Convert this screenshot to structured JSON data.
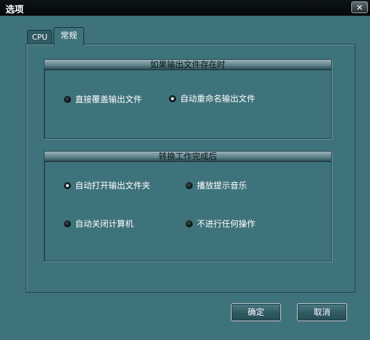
{
  "window": {
    "title": "选项",
    "close_glyph": "✕"
  },
  "tabs": [
    {
      "label": "CPU",
      "active": false
    },
    {
      "label": "常规",
      "active": true
    }
  ],
  "groups": {
    "output_exists": {
      "header": "如果输出文件存在时",
      "options": [
        {
          "label": "直接覆盖输出文件",
          "checked": false
        },
        {
          "label": "自动重命名输出文件",
          "checked": true
        }
      ]
    },
    "after_convert": {
      "header": "转换工作完成后",
      "options": [
        {
          "label": "自动打开输出文件夹",
          "checked": true
        },
        {
          "label": "播放提示音乐",
          "checked": false
        },
        {
          "label": "自动关闭计算机",
          "checked": false
        },
        {
          "label": "不进行任何操作",
          "checked": false
        }
      ]
    }
  },
  "buttons": {
    "ok": "确定",
    "cancel": "取消"
  },
  "colors": {
    "background": "#3f737b",
    "titlebar": "#0a1012",
    "text": "#ffffff"
  }
}
